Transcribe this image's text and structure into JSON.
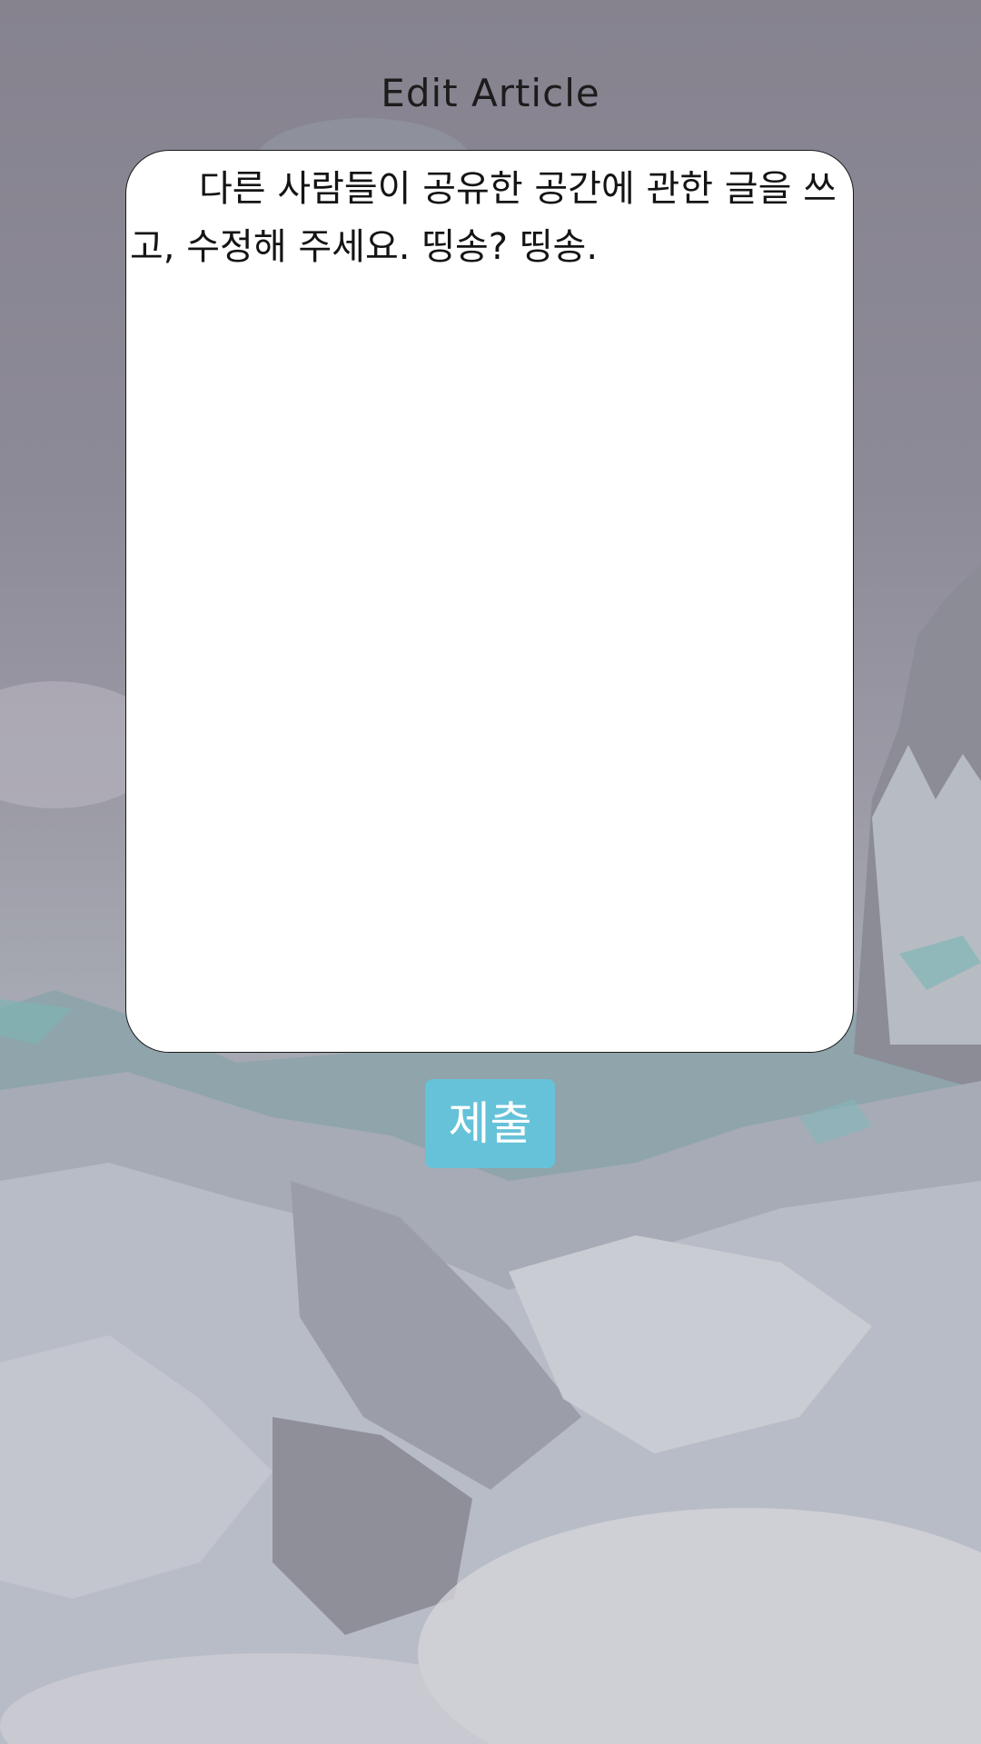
{
  "header": {
    "title": "Edit Article"
  },
  "editor": {
    "value": "다른 사람들이 공유한 공간에 관한 글을 쓰고, 수정해 주세요. 띵송? 띵송."
  },
  "actions": {
    "submit_label": "제출"
  },
  "colors": {
    "accent": "#66c2d9",
    "editor_background": "#ffffff",
    "title_text": "#1c1c1c"
  },
  "background": {
    "icon": "snowy-mountain-landscape-photo"
  }
}
